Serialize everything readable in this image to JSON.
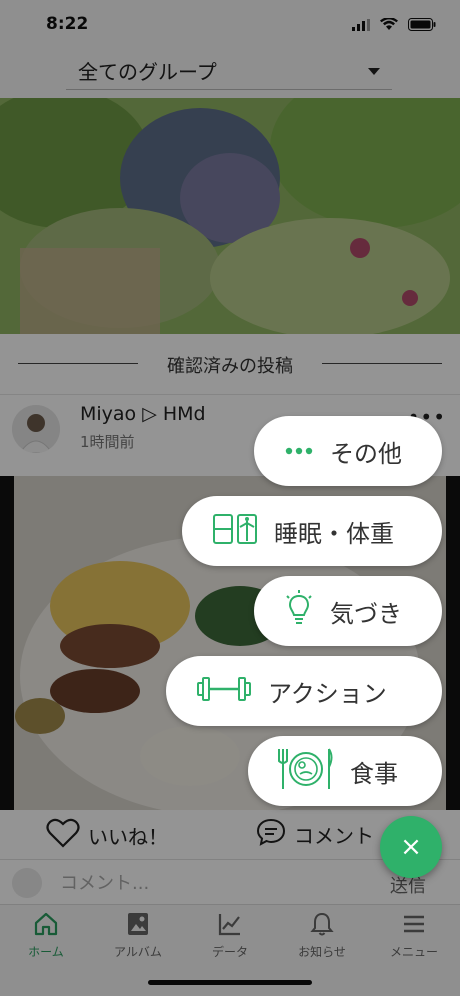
{
  "status_bar": {
    "time": "8:22"
  },
  "header": {
    "group_select_label": "全てのグループ"
  },
  "section": {
    "title": "確認済みの投稿"
  },
  "post": {
    "author": "Miyao ▷ HMd",
    "time_ago": "1時間前",
    "more": "•••"
  },
  "actions": {
    "like_label": "いいね！",
    "comment_label": "コメント"
  },
  "comment_bar": {
    "placeholder": "コメント...",
    "send_label": "送信"
  },
  "tabs": [
    {
      "label": "ホーム",
      "icon": "home-icon",
      "active": true
    },
    {
      "label": "アルバム",
      "icon": "album-icon",
      "active": false
    },
    {
      "label": "データ",
      "icon": "chart-icon",
      "active": false
    },
    {
      "label": "お知らせ",
      "icon": "bell-icon",
      "active": false
    },
    {
      "label": "メニュー",
      "icon": "menu-icon",
      "active": false
    }
  ],
  "fab_menu": {
    "items": [
      {
        "label": "その他",
        "icon": "dots-icon"
      },
      {
        "label": "睡眠・体重",
        "icon": "sleep-weight-icon"
      },
      {
        "label": "気づき",
        "icon": "lightbulb-icon"
      },
      {
        "label": "アクション",
        "icon": "dumbbell-icon"
      },
      {
        "label": "食事",
        "icon": "meal-icon"
      }
    ],
    "close_symbol": "×"
  },
  "colors": {
    "accent": "#2fb16a",
    "tab_active": "#2a9d5f"
  }
}
